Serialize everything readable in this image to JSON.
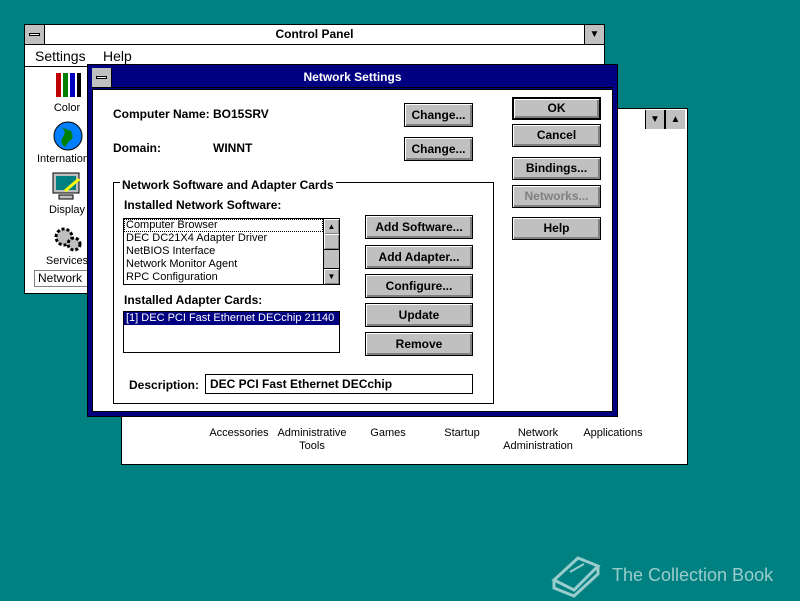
{
  "control_panel": {
    "title": "Control Panel",
    "menu": [
      "Settings",
      "Help"
    ],
    "icons": [
      "Color",
      "International",
      "Display",
      "Services"
    ],
    "status_partial": "Network"
  },
  "group_window": {
    "icons": [
      "Accessories",
      "Administrative Tools",
      "Games",
      "Startup",
      "Network Administration",
      "Applications"
    ]
  },
  "dialog": {
    "title": "Network Settings",
    "computer_name_label": "Computer Name:",
    "computer_name_value": "BO15SRV",
    "domain_label": "Domain:",
    "domain_value": "WINNT",
    "change_label": "Change...",
    "group_title": "Network Software and Adapter Cards",
    "installed_software_label": "Installed Network Software:",
    "software_list": [
      "Computer Browser",
      "DEC DC21X4 Adapter Driver",
      "NetBIOS Interface",
      "Network Monitor Agent",
      "RPC Configuration"
    ],
    "installed_adapters_label": "Installed Adapter Cards:",
    "adapter_list": [
      "[1] DEC PCI Fast Ethernet DECchip 21140"
    ],
    "description_label": "Description:",
    "description_value": "DEC PCI Fast Ethernet DECchip",
    "buttons": {
      "add_software": "Add Software...",
      "add_adapter": "Add Adapter...",
      "configure": "Configure...",
      "update": "Update",
      "remove": "Remove",
      "ok": "OK",
      "cancel": "Cancel",
      "bindings": "Bindings...",
      "networks": "Networks...",
      "help": "Help"
    }
  },
  "watermark": "The Collection Book",
  "colors": {
    "desktop": "#008080",
    "active_title": "#000080",
    "selection": "#000080",
    "button_face": "#c0c0c0"
  }
}
